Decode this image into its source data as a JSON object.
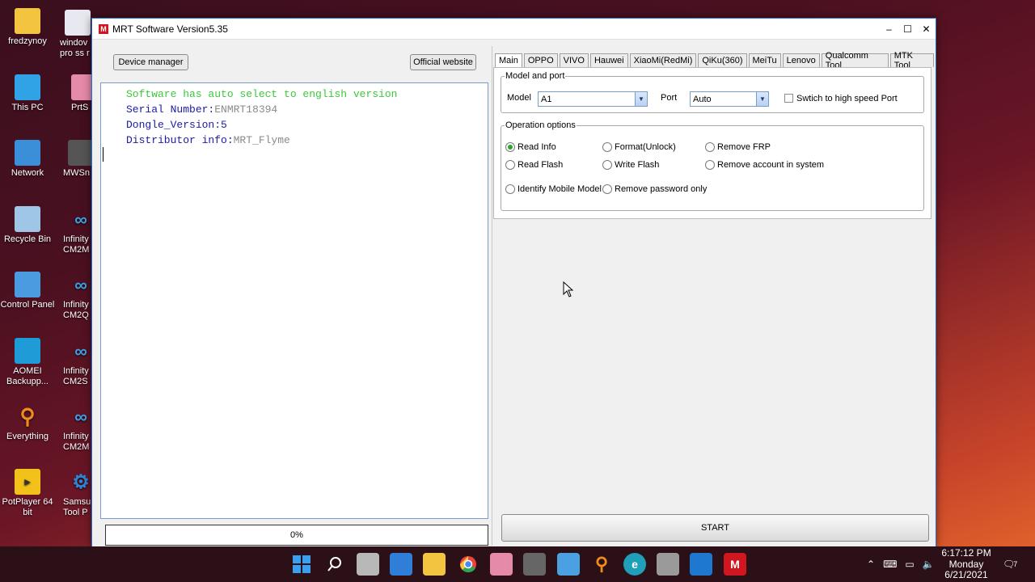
{
  "desktop": {
    "icons_col1": [
      {
        "label": "fredzynoy",
        "icon": "folder-icon"
      },
      {
        "label": "This PC",
        "icon": "this-pc-icon"
      },
      {
        "label": "Network",
        "icon": "network-icon"
      },
      {
        "label": "Recycle Bin",
        "icon": "recycle-bin-icon"
      },
      {
        "label": "Control Panel",
        "icon": "control-panel-icon"
      },
      {
        "label": "AOMEI Backupp...",
        "icon": "aomei-icon"
      },
      {
        "label": "Everything",
        "icon": "everything-icon"
      },
      {
        "label": "PotPlayer 64 bit",
        "icon": "potplayer-icon"
      }
    ],
    "icons_col2": [
      {
        "label": "windov pro ss r",
        "icon": "document-icon"
      },
      {
        "label": "PrtS",
        "icon": "prtscr-icon"
      },
      {
        "label": "MWSn",
        "icon": "camera-icon"
      },
      {
        "label": "Infinity CM2M",
        "icon": "infinity-icon"
      },
      {
        "label": "Infinity CM2Q",
        "icon": "infinity-icon"
      },
      {
        "label": "Infinity CM2S",
        "icon": "infinity-icon"
      },
      {
        "label": "Infinity CM2M",
        "icon": "infinity-icon"
      },
      {
        "label": "Samsu Tool P",
        "icon": "gear-icon"
      }
    ]
  },
  "window": {
    "title": "MRT Software Version5.35",
    "controls": {
      "minimize": "–",
      "maximize": "☐",
      "close": "✕"
    }
  },
  "toolbar": {
    "device_manager": "Device manager",
    "official_website": "Official website"
  },
  "log": {
    "line1": "Software has auto select to english version",
    "line2_label": "Serial Number:",
    "line2_value": "ENMRT18394",
    "line3": "Dongle_Version:5",
    "line4_label": "Distributor info:",
    "line4_value": "MRT_Flyme"
  },
  "progress": {
    "value": 0,
    "label": "0%"
  },
  "tabs": [
    "Main",
    "OPPO",
    "VIVO",
    "Hauwei",
    "XiaoMi(RedMi)",
    "QiKu(360)",
    "MeiTu",
    "Lenovo",
    "Qualcomm Tool",
    "MTK Tool"
  ],
  "model_port": {
    "legend": "Model and port",
    "model_label": "Model",
    "model_value": "A1",
    "port_label": "Port",
    "port_value": "Auto",
    "high_speed_label": "Swtich to high speed Port",
    "high_speed_checked": false
  },
  "operation": {
    "legend": "Operation options",
    "options": [
      {
        "label": "Read Info",
        "selected": true
      },
      {
        "label": "Format(Unlock)",
        "selected": false
      },
      {
        "label": "Remove FRP",
        "selected": false
      },
      {
        "label": "Read Flash",
        "selected": false
      },
      {
        "label": "Write Flash",
        "selected": false
      },
      {
        "label": "Remove account in system",
        "selected": false
      },
      {
        "label": "Identify Mobile Model",
        "selected": false
      },
      {
        "label": "Remove password only",
        "selected": false
      }
    ]
  },
  "start_button": "START",
  "taskbar": {
    "apps": [
      "start-icon",
      "search-icon",
      "task-view-icon",
      "widgets-icon",
      "file-explorer-icon",
      "chrome-icon",
      "prtscr-icon",
      "camera-icon",
      "notepad-icon",
      "everything-icon",
      "edge-icon",
      "tools-icon",
      "photos-icon",
      "mrt-icon"
    ],
    "clock_time": "6:17:12 PM",
    "clock_day": "Monday",
    "clock_date": "6/21/2021",
    "notification_count": "7"
  },
  "colors": {
    "log_green": "#3cc83c",
    "log_blue": "#1a1aa8",
    "log_gray": "#8a8a8a",
    "radio_on": "#2aa42a",
    "app_red": "#d0161e"
  }
}
